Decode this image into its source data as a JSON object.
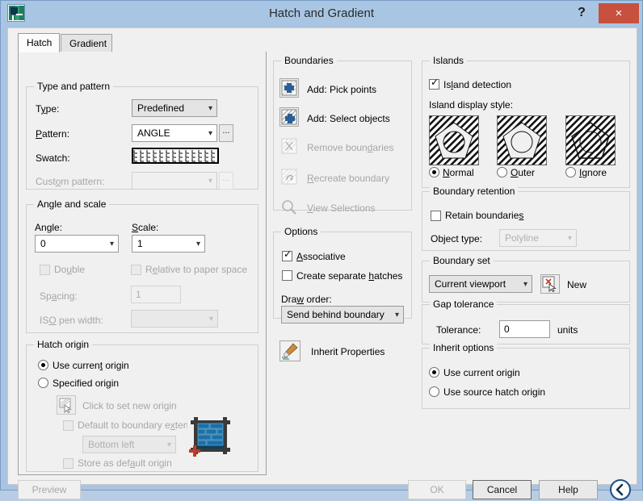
{
  "window": {
    "title": "Hatch and Gradient",
    "app_icon": "autocad-icon",
    "help_label": "?",
    "close_label": "×",
    "titlebar_color": "#a8c6e3",
    "close_color": "#c7503f"
  },
  "tabs": [
    {
      "label": "Hatch",
      "active": true
    },
    {
      "label": "Gradient",
      "active": false
    }
  ],
  "hatch_tab": {
    "type_and_pattern": {
      "title": "Type and pattern",
      "type_label": "Type:",
      "type_value": "Predefined",
      "pattern_label": "Pattern:",
      "pattern_value": "ANGLE",
      "pattern_browse_label": "...",
      "swatch_label": "Swatch:",
      "swatch_pattern": "ANGLE",
      "custom_pattern_label": "Custom pattern:",
      "custom_pattern_value": "",
      "custom_browse_label": "..."
    },
    "angle_and_scale": {
      "title": "Angle and scale",
      "angle_label": "Angle:",
      "angle_value": "0",
      "scale_label": "Scale:",
      "scale_value": "1",
      "double_label": "Double",
      "double_checked": false,
      "relative_label": "Relative to paper space",
      "relative_checked": false,
      "spacing_label": "Spacing:",
      "spacing_value": "1",
      "iso_pen_label": "ISO pen width:",
      "iso_pen_value": ""
    },
    "hatch_origin": {
      "title": "Hatch origin",
      "use_current_label": "Use current origin",
      "specified_label": "Specified origin",
      "selected": "use_current",
      "click_set_label": "Click to set new origin",
      "click_set_icon": "pick-origin-icon",
      "default_extents_label": "Default to boundary extents",
      "default_extents_checked": false,
      "extents_corner_value": "Bottom left",
      "store_default_label": "Store as default origin",
      "store_default_checked": false,
      "preview_icon": "brick-origin-preview-icon"
    }
  },
  "boundaries": {
    "title": "Boundaries",
    "items": [
      {
        "label": "Add: Pick points",
        "icon": "add-pick-points-icon",
        "enabled": true
      },
      {
        "label": "Add: Select objects",
        "icon": "add-select-objects-icon",
        "enabled": true
      },
      {
        "label": "Remove boundaries",
        "icon": "remove-boundaries-icon",
        "enabled": false
      },
      {
        "label": "Recreate boundary",
        "icon": "recreate-boundary-icon",
        "enabled": false
      },
      {
        "label": "View Selections",
        "icon": "view-selections-icon",
        "enabled": false
      }
    ]
  },
  "options": {
    "title": "Options",
    "associative_label": "Associative",
    "associative_checked": true,
    "separate_hatches_label": "Create separate hatches",
    "separate_hatches_checked": false,
    "draw_order_label": "Draw order:",
    "draw_order_value": "Send behind boundary",
    "inherit_properties_label": "Inherit Properties",
    "inherit_properties_icon": "paintbrush-icon"
  },
  "islands": {
    "title": "Islands",
    "detection_label": "Island detection",
    "detection_checked": true,
    "display_style_label": "Island display style:",
    "styles": [
      {
        "label": "Normal",
        "selected": true
      },
      {
        "label": "Outer",
        "selected": false
      },
      {
        "label": "Ignore",
        "selected": false
      }
    ]
  },
  "boundary_retention": {
    "title": "Boundary retention",
    "retain_label": "Retain boundaries",
    "retain_checked": false,
    "object_type_label": "Object type:",
    "object_type_value": "Polyline"
  },
  "boundary_set": {
    "title": "Boundary set",
    "value": "Current viewport",
    "new_label": "New",
    "new_icon": "new-boundary-set-icon"
  },
  "gap_tolerance": {
    "title": "Gap tolerance",
    "tolerance_label": "Tolerance:",
    "tolerance_value": "0",
    "units_label": "units"
  },
  "inherit_options": {
    "title": "Inherit options",
    "use_current_label": "Use current origin",
    "use_source_label": "Use source hatch origin",
    "selected": "use_current"
  },
  "footer": {
    "preview_label": "Preview",
    "preview_enabled": false,
    "ok_label": "OK",
    "ok_enabled": false,
    "cancel_label": "Cancel",
    "help_label": "Help",
    "expand_icon": "collapse-left-icon"
  }
}
